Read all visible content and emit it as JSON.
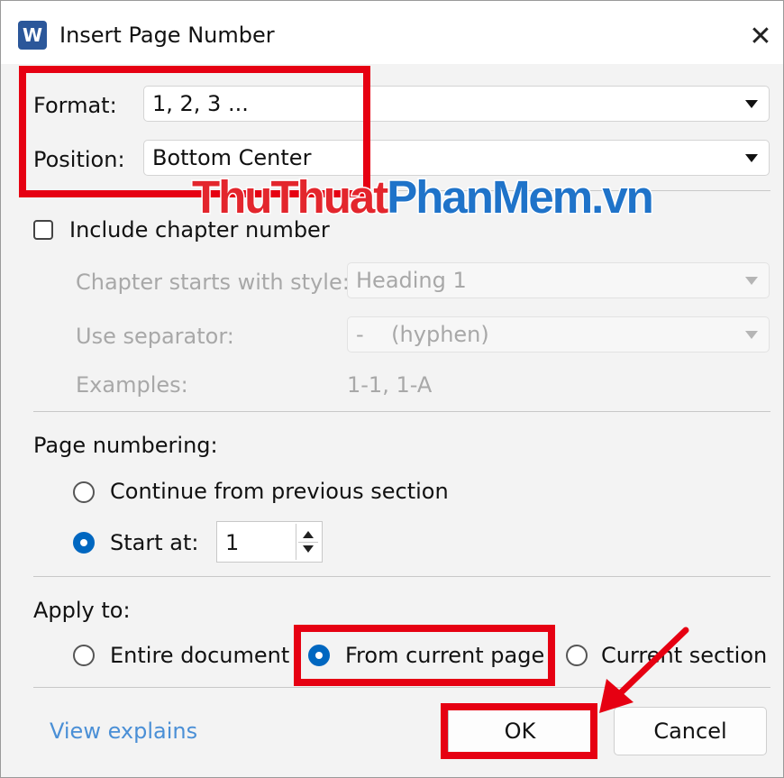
{
  "window": {
    "title": "Insert Page Number",
    "app_icon_letter": "W",
    "close_glyph": "✕"
  },
  "format": {
    "label": "Format:",
    "value": "1, 2, 3 ..."
  },
  "position": {
    "label": "Position:",
    "value": "Bottom Center"
  },
  "chapter": {
    "include_label": "Include chapter number",
    "include_checked": false,
    "style_label": "Chapter starts with style:",
    "style_value": "Heading 1",
    "separator_label": "Use separator:",
    "separator_value": "-    (hyphen)",
    "examples_label": "Examples:",
    "examples_value": "1-1, 1-A"
  },
  "page_numbering": {
    "heading": "Page numbering:",
    "continue_label": "Continue from previous section",
    "start_label": "Start at:",
    "start_value": "1",
    "selected": "start_at"
  },
  "apply_to": {
    "heading": "Apply to:",
    "options": [
      "Entire document",
      "From current page",
      "Current section"
    ],
    "selected": "From current page"
  },
  "footer": {
    "link": "View explains",
    "ok": "OK",
    "cancel": "Cancel"
  },
  "watermark": {
    "part1": "ThuThuat",
    "part2": "PhanMem.vn"
  },
  "colors": {
    "highlight": "#e60012",
    "accent": "#0067c0",
    "link": "#4a8fd6",
    "word_blue": "#2b579a"
  }
}
